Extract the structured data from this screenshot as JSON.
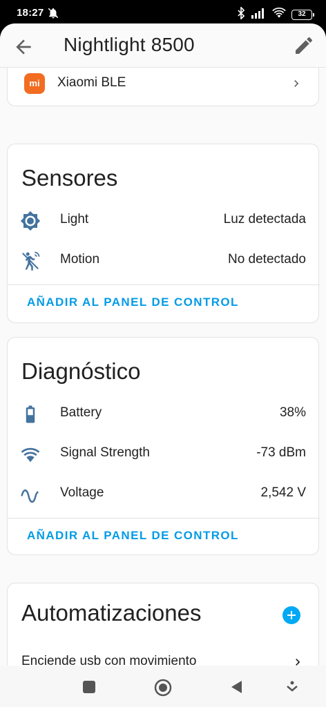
{
  "status_bar": {
    "time": "18:27",
    "battery": "32"
  },
  "app_bar": {
    "title": "Nightlight 8500"
  },
  "integration": {
    "logo_text": "mi",
    "label": "Xiaomi BLE"
  },
  "sensors": {
    "title": "Sensores",
    "rows": [
      {
        "icon": "brightness-icon",
        "label": "Light",
        "value": "Luz detectada"
      },
      {
        "icon": "motion-sensor-icon",
        "label": "Motion",
        "value": "No detectado"
      }
    ],
    "action_label": "AÑADIR AL PANEL DE CONTROL"
  },
  "diagnostics": {
    "title": "Diagnóstico",
    "rows": [
      {
        "icon": "battery-icon",
        "label": "Battery",
        "value": "38%"
      },
      {
        "icon": "wifi-icon",
        "label": "Signal Strength",
        "value": "-73 dBm"
      },
      {
        "icon": "sine-wave-icon",
        "label": "Voltage",
        "value": "2,542 V"
      }
    ],
    "action_label": "AÑADIR AL PANEL DE CONTROL"
  },
  "automations": {
    "title": "Automatizaciones",
    "items": [
      {
        "label": "Enciende usb con movimiento"
      }
    ]
  },
  "colors": {
    "accent": "#039be5",
    "icon": "#44739e",
    "xiaomi": "#f26c22"
  }
}
